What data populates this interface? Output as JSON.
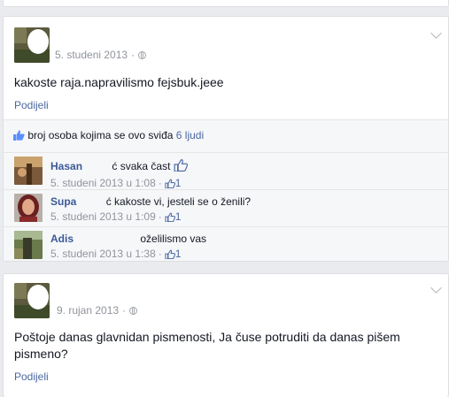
{
  "post1": {
    "date": "5. studeni 2013",
    "text": "kakoste raja.napravilismo fejsbuk.jeee",
    "share_label": "Podijeli",
    "likes": {
      "text": "broj osoba kojima se ovo sviđa",
      "count_label": "6 ljudi"
    },
    "comments": [
      {
        "name": "Hasan",
        "text": "ć svaka čast",
        "date": "5. studeni 2013 u 1:08",
        "likes": "1"
      },
      {
        "name": "Supa",
        "text": "ć kakoste vi, jesteli se o ženili?",
        "date": "5. studeni 2013 u 1:09",
        "likes": "1"
      },
      {
        "name": "Adis",
        "text": "oželilismo vas",
        "date": "5. studeni 2013 u 1:38",
        "likes": "1"
      }
    ]
  },
  "post2": {
    "date": "9. rujan 2013",
    "text": "Poštoje danas glavnidan pismenosti, Ja čuse potruditi da danas pišem pismeno?",
    "share_label": "Podijeli"
  },
  "colors": {
    "link": "#3b5998",
    "muted": "#90949c",
    "background": "#e9ebee"
  },
  "icons": [
    "globe-icon",
    "chevron-down-icon",
    "like-thumb-icon"
  ]
}
